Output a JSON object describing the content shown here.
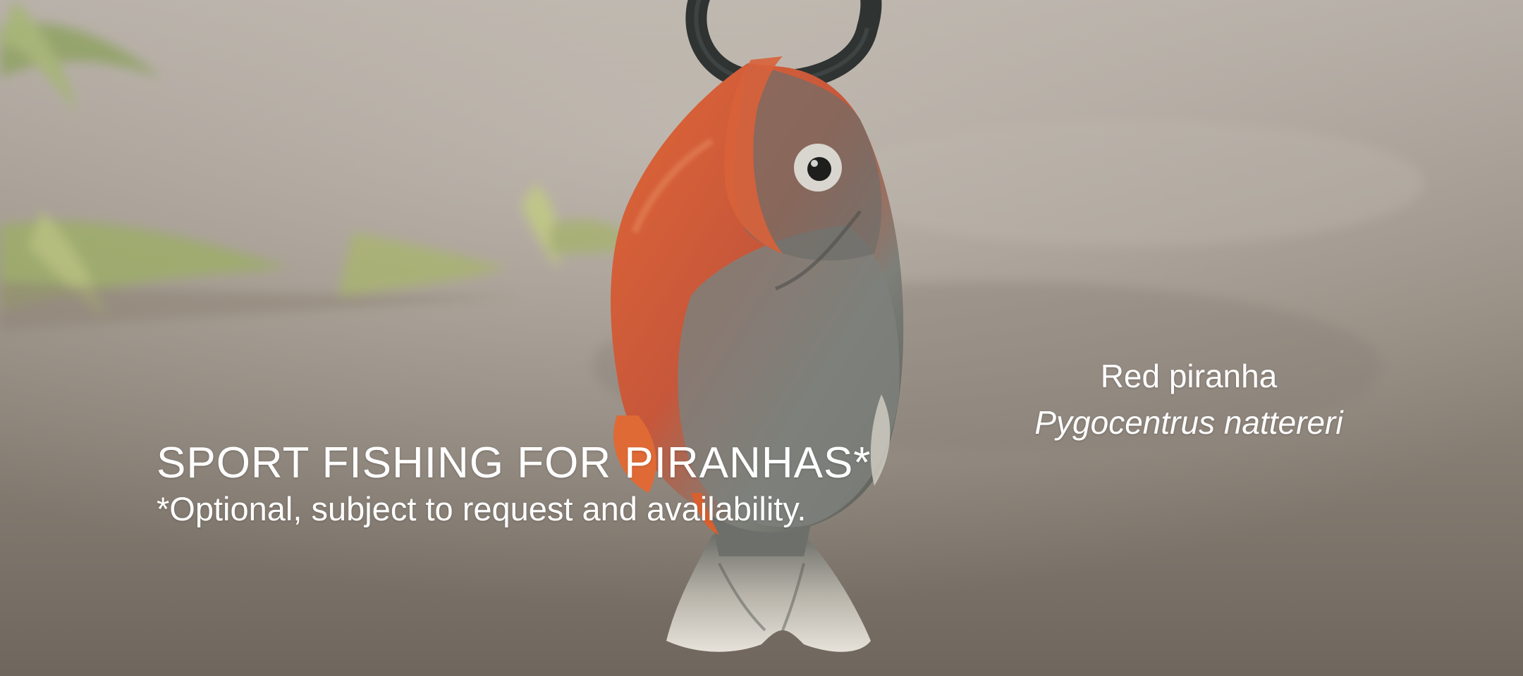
{
  "slide": {
    "headline": "SPORT FISHING FOR PIRANHAS*",
    "note": "*Optional, subject to request and availability.",
    "species": {
      "common_name": "Red piranha",
      "scientific_name": "Pygocentrus nattereri"
    }
  },
  "colors": {
    "text": "#ffffff",
    "water": "#8c837a",
    "fish_orange": "#d9582f",
    "fish_silver": "#7c7e7a"
  }
}
